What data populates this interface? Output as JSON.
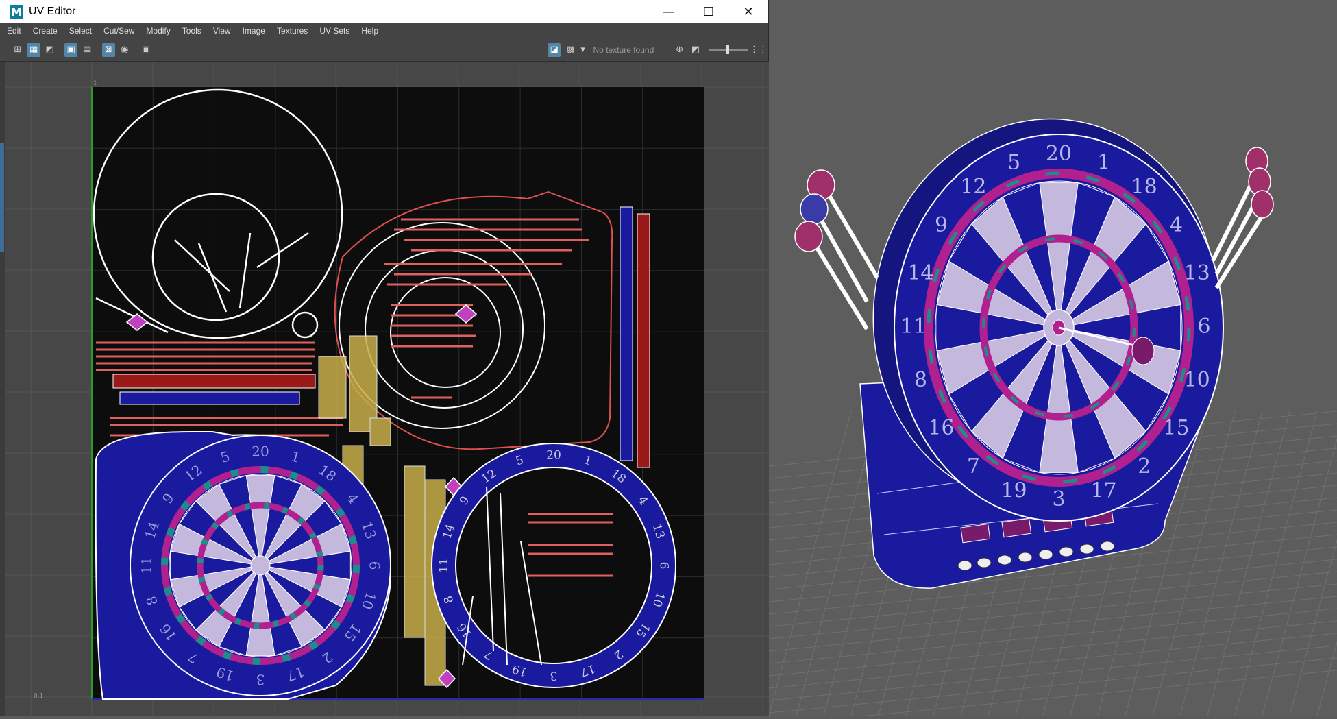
{
  "window": {
    "title": "UV Editor",
    "app_icon": "M",
    "minimize": "—",
    "maximize": "☐",
    "close": "✕"
  },
  "menu": [
    "Edit",
    "Create",
    "Select",
    "Cut/Sew",
    "Modify",
    "Tools",
    "View",
    "Image",
    "Textures",
    "UV Sets",
    "Help"
  ],
  "toolbar": {
    "texture_status": "No texture found",
    "icons": [
      "uv-shell-icon",
      "isolate-icon",
      "checker-icon",
      "grid-icon",
      "shaded-icon",
      "texture-borders-icon",
      "snapshot-icon"
    ]
  },
  "uv_view": {
    "tick_origin": "-0.1",
    "tick_top": "1"
  },
  "dartboard_numbers": [
    "20",
    "1",
    "18",
    "4",
    "13",
    "6",
    "10",
    "15",
    "2",
    "17",
    "3",
    "19",
    "7",
    "16",
    "8",
    "11",
    "14",
    "9",
    "12",
    "5"
  ],
  "colors": {
    "wire_blue": "#1a1a9e",
    "magenta": "#b0208e",
    "teal": "#1d8c8c",
    "light_segment": "#c4b9dc",
    "accent_selected": "#5285a6"
  }
}
